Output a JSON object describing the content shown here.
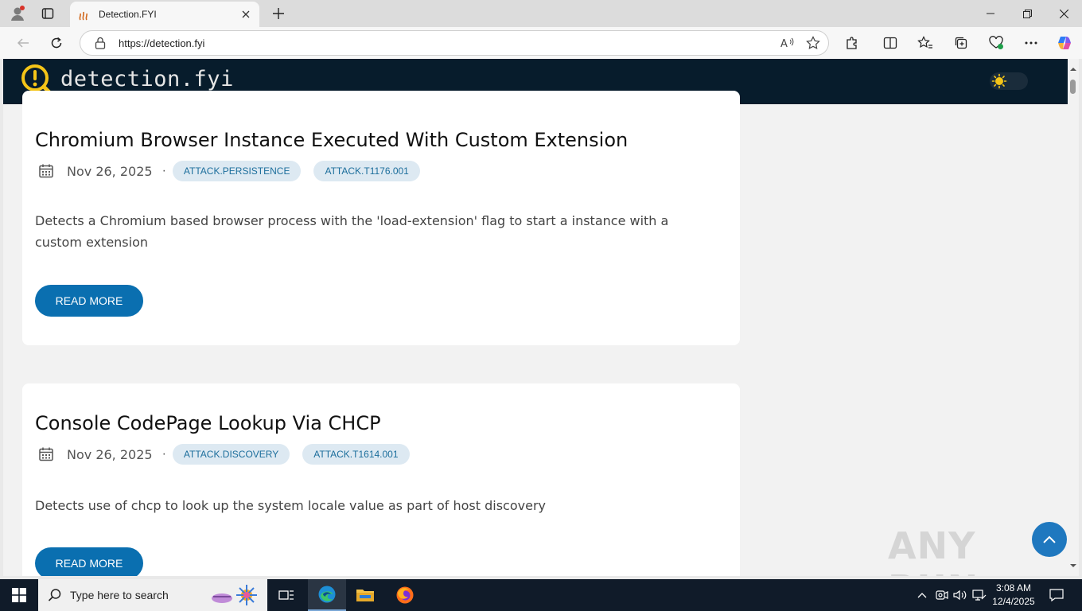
{
  "browser": {
    "tab_title": "Detection.FYI",
    "url": "https://detection.fyi"
  },
  "site": {
    "brand": "detection.fyi"
  },
  "posts": [
    {
      "title": "Chromium Browser Instance Executed With Custom Extension",
      "date": "Nov 26, 2025",
      "separator": "·",
      "tags": [
        "ATTACK.PERSISTENCE",
        "ATTACK.T1176.001"
      ],
      "description": "Detects a Chromium based browser process with the 'load-extension' flag to start a instance with a custom extension",
      "read_more": "READ MORE"
    },
    {
      "title": "Console CodePage Lookup Via CHCP",
      "date": "Nov 26, 2025",
      "separator": "·",
      "tags": [
        "ATTACK.DISCOVERY",
        "ATTACK.T1614.001"
      ],
      "description": "Detects use of chcp to look up the system locale value as part of host discovery",
      "read_more": "READ MORE"
    }
  ],
  "watermark": "ANY RUN",
  "taskbar": {
    "search_placeholder": "Type here to search",
    "time": "3:08 AM",
    "date": "12/4/2025"
  },
  "colors": {
    "header_bg": "#071c2c",
    "accent": "#0a6fb0",
    "tag_bg": "#dde9f2",
    "tag_text": "#1c6e9c",
    "logo_yellow": "#f5c518"
  }
}
